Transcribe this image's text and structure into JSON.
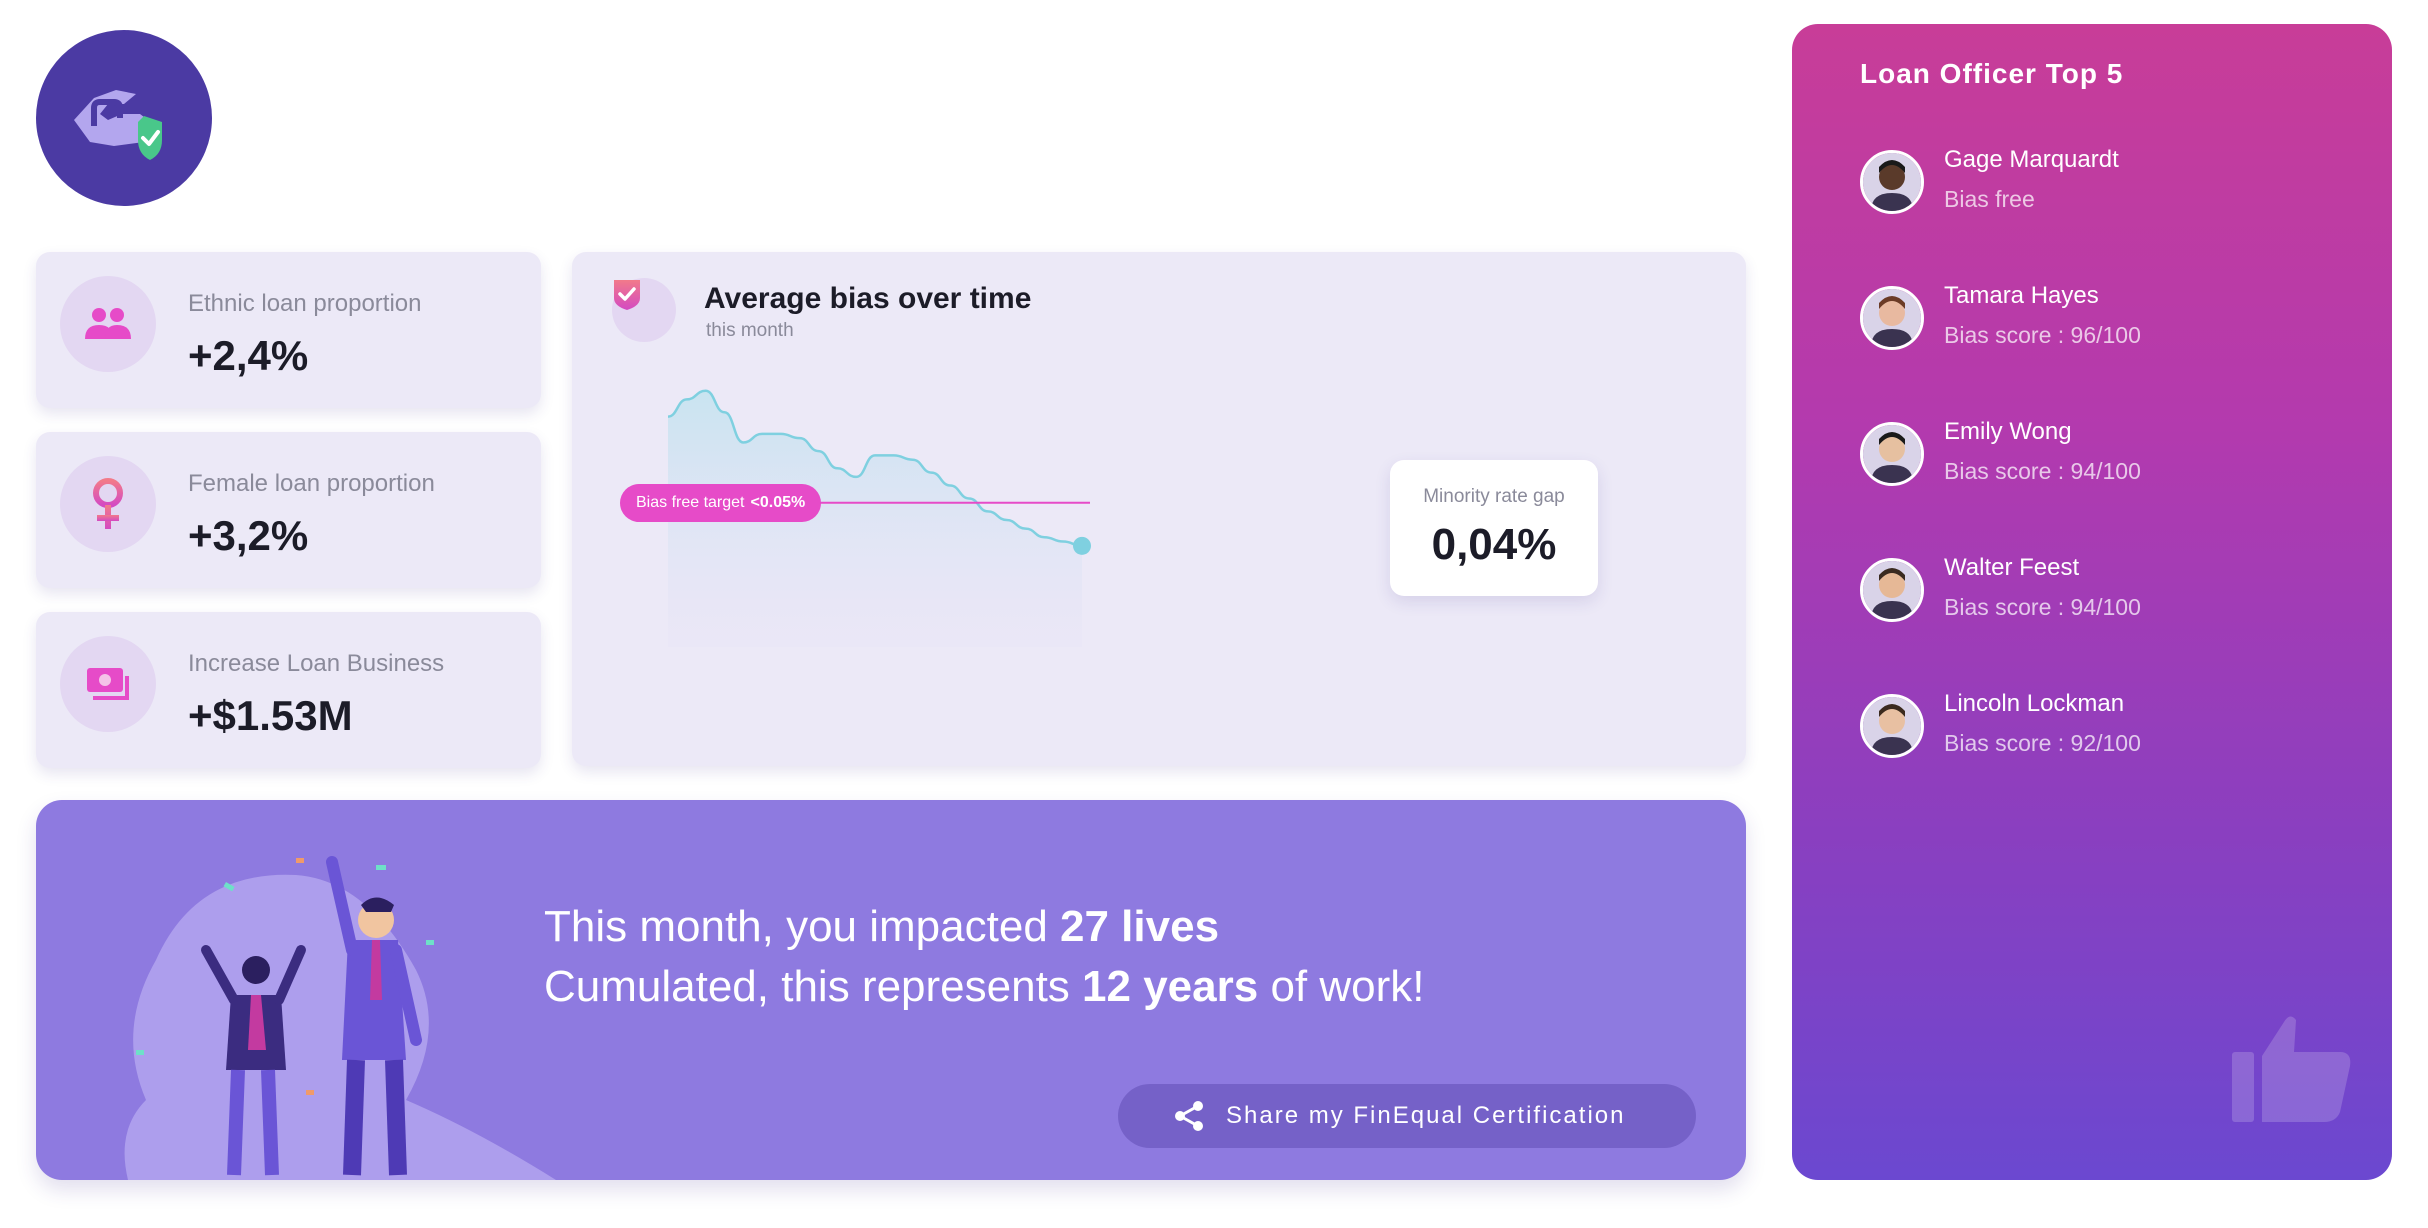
{
  "logo": {
    "icon": "handshake-shield-icon"
  },
  "stats": [
    {
      "label": "Ethnic loan proportion",
      "value": "+2,4%",
      "icon": "people-icon"
    },
    {
      "label": "Female loan proportion",
      "value": "+3,2%",
      "icon": "female-icon"
    },
    {
      "label": "Increase Loan Business",
      "value": "+$1.53M",
      "icon": "money-icon"
    }
  ],
  "chart": {
    "title": "Average bias over time",
    "subtitle": "this month",
    "target_label": "Bias free target",
    "target_value": "<0.05%",
    "gap_label": "Minority rate gap",
    "gap_value": "0,04%"
  },
  "chart_data": {
    "type": "area",
    "title": "Average bias over time",
    "subtitle": "this month",
    "x": [
      1,
      2,
      3,
      4,
      5,
      6,
      7,
      8,
      9,
      10,
      11,
      12,
      13,
      14,
      15,
      16,
      17,
      18,
      19,
      20,
      21,
      22,
      23
    ],
    "series": [
      {
        "values": [
          0.07,
          0.074,
          0.076,
          0.071,
          0.064,
          0.066,
          0.066,
          0.065,
          0.062,
          0.058,
          0.056,
          0.061,
          0.061,
          0.06,
          0.057,
          0.054,
          0.051,
          0.048,
          0.046,
          0.044,
          0.042,
          0.041,
          0.04
        ]
      }
    ],
    "reference_line": {
      "label": "Bias free target <0.05%",
      "value": 0.05
    },
    "ylim": [
      0.02,
      0.085
    ],
    "grid": false,
    "colors": {
      "line": "#7fd0e0",
      "target": "#e64bc8",
      "end_point": "#7fd0e0"
    }
  },
  "impact": {
    "line1_pre": "This month, you impacted ",
    "line1_bold": "27 lives",
    "line2_pre": "Cumulated, this represents ",
    "line2_bold": "12 years",
    "line2_post": " of work!",
    "share_label": "Share my FinEqual Certification"
  },
  "officers": {
    "title": "Loan Officer Top 5",
    "items": [
      {
        "name": "Gage Marquardt",
        "score": "Bias free",
        "skin": "#5a3a2a",
        "hair": "#1a1a1a"
      },
      {
        "name": "Tamara Hayes",
        "score": "Bias score : 96/100",
        "skin": "#e8b9a0",
        "hair": "#6b3b26"
      },
      {
        "name": "Emily Wong",
        "score": "Bias score : 94/100",
        "skin": "#e6c0a0",
        "hair": "#1a1a1a"
      },
      {
        "name": "Walter Feest",
        "score": "Bias score : 94/100",
        "skin": "#e6b896",
        "hair": "#3a2a20"
      },
      {
        "name": "Lincoln Lockman",
        "score": "Bias score : 92/100",
        "skin": "#e8c0a2",
        "hair": "#3b2a1e"
      }
    ]
  },
  "colors": {
    "accent": "#e64bc8",
    "card_bg": "#ece9f7",
    "impact_bg": "#8e7ae0",
    "logo_bg": "#4b3aa3",
    "shield_green": "#49c78a"
  }
}
